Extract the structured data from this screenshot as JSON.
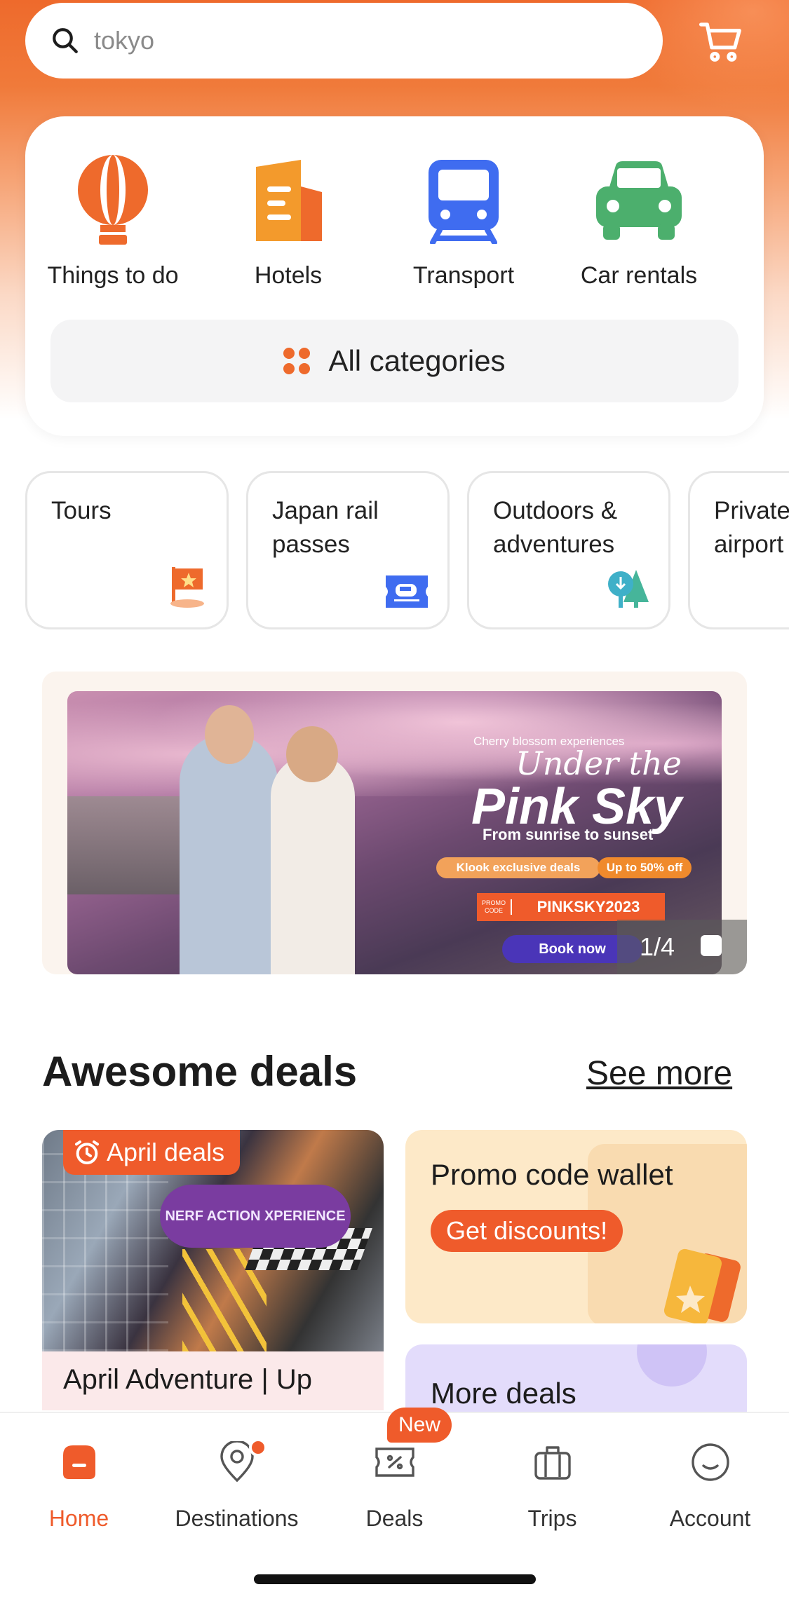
{
  "search": {
    "value": "tokyo",
    "icon": "search-icon"
  },
  "header": {
    "cart_icon": "cart-icon"
  },
  "categories": [
    {
      "label": "Things to do",
      "icon": "balloon-icon",
      "color": "#ee6a2c"
    },
    {
      "label": "Hotels",
      "icon": "hotel-icon",
      "color": "#f39a2c"
    },
    {
      "label": "Transport",
      "icon": "train-icon",
      "color": "#3f6cf0"
    },
    {
      "label": "Car rentals",
      "icon": "car-icon",
      "color": "#4caf6d"
    }
  ],
  "all_categories": {
    "label": "All categories",
    "icon": "grid-dots-icon"
  },
  "subcategories": [
    {
      "label": "Tours",
      "icon": "flag-icon"
    },
    {
      "label": "Japan rail passes",
      "icon": "rail-pass-icon"
    },
    {
      "label": "Outdoors & adventures",
      "icon": "trees-icon"
    },
    {
      "label": "Private airport",
      "icon": ""
    }
  ],
  "banner": {
    "tagline": "Cherry blossom experiences",
    "script_title": "Under the",
    "title": "Pink Sky",
    "subtitle": "From sunrise to sunset",
    "pill_1": "Klook exclusive deals",
    "pill_2": "Up to 50% off",
    "promo_label": "PROMO CODE",
    "promo_code": "PINKSKY2023",
    "cta": "Book now",
    "counter": "1/4"
  },
  "deals": {
    "title": "Awesome deals",
    "see_more": "See more",
    "main_card": {
      "badge": "April deals",
      "image_text": "NERF ACTION XPERIENCE",
      "name": "April Adventure | Up"
    },
    "promo_card": {
      "title": "Promo code wallet",
      "button": "Get discounts!"
    },
    "more_card": {
      "title": "More deals"
    }
  },
  "bottom_nav": {
    "items": [
      {
        "label": "Home",
        "icon": "home-icon",
        "active": true
      },
      {
        "label": "Destinations",
        "icon": "location-pin-icon"
      },
      {
        "label": "Deals",
        "icon": "discount-ticket-icon"
      },
      {
        "label": "Trips",
        "icon": "suitcase-icon"
      },
      {
        "label": "Account",
        "icon": "smiley-icon"
      }
    ],
    "new_badge": "New"
  },
  "colors": {
    "brand": "#ef5b2b",
    "active": "#ef5b2b"
  }
}
